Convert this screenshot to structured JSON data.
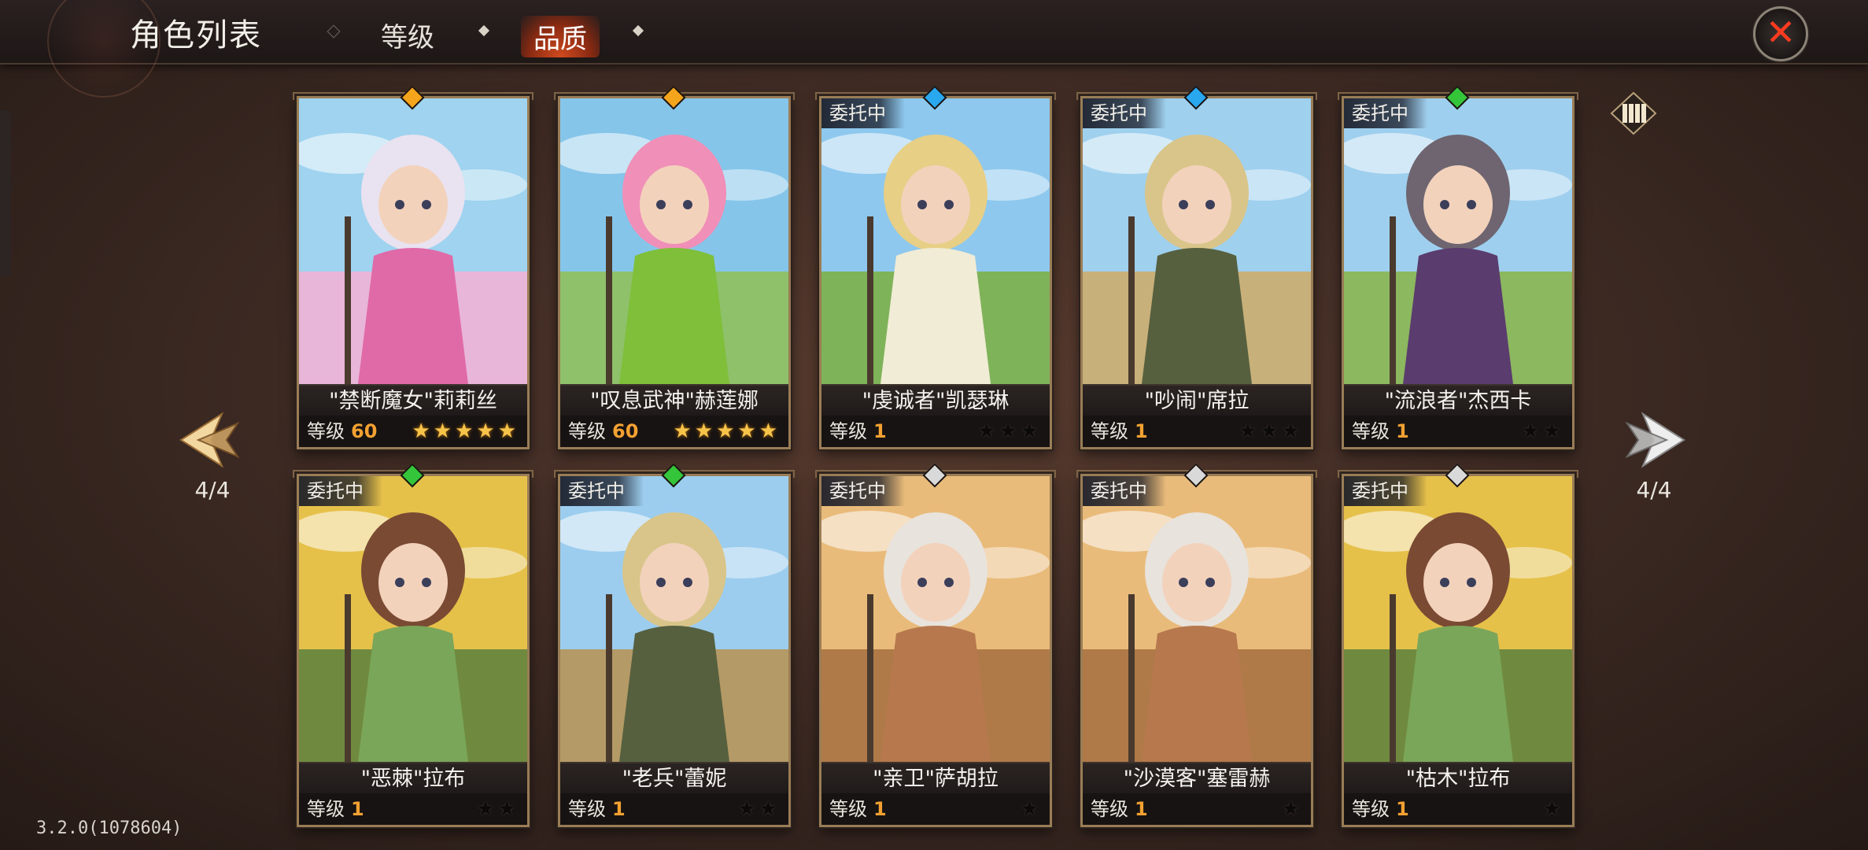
{
  "header": {
    "title": "角色列表",
    "tabs": [
      {
        "label": "等级",
        "active": false
      },
      {
        "label": "品质",
        "active": true
      }
    ],
    "close_icon": "close-icon"
  },
  "pagination": {
    "left_indicator": "4/4",
    "right_indicator": "4/4"
  },
  "colors": {
    "gold": "#f7c44a",
    "level_orange": "#f3a132",
    "close_red": "#ff3b1f",
    "gem_orange": "#f4a51c",
    "gem_blue": "#29a8f0",
    "gem_green": "#35c53a",
    "gem_white": "#d9d9d9"
  },
  "level_label": "等级",
  "cards": [
    {
      "name": "\"禁断魔女\"莉莉丝",
      "level": "60",
      "stars": "★★★★★",
      "star_style": "gold",
      "gem": "orange",
      "commission": ""
    },
    {
      "name": "\"叹息武神\"赫莲娜",
      "level": "60",
      "stars": "★★★★★",
      "star_style": "gold",
      "gem": "orange",
      "commission": ""
    },
    {
      "name": "\"虔诚者\"凯瑟琳",
      "level": "1",
      "stars": "★★★",
      "star_style": "dark",
      "gem": "blue",
      "commission": "委托中"
    },
    {
      "name": "\"吵闹\"席拉",
      "level": "1",
      "stars": "★★★",
      "star_style": "dark",
      "gem": "blue",
      "commission": "委托中"
    },
    {
      "name": "\"流浪者\"杰西卡",
      "level": "1",
      "stars": "★★",
      "star_style": "dark",
      "gem": "green",
      "commission": "委托中"
    },
    {
      "name": "\"恶棘\"拉布",
      "level": "1",
      "stars": "★★",
      "star_style": "dark",
      "gem": "green",
      "commission": "委托中"
    },
    {
      "name": "\"老兵\"蕾妮",
      "level": "1",
      "stars": "★★",
      "star_style": "dark",
      "gem": "green",
      "commission": "委托中"
    },
    {
      "name": "\"亲卫\"萨胡拉",
      "level": "1",
      "stars": "★",
      "star_style": "dark",
      "gem": "white",
      "commission": "委托中"
    },
    {
      "name": "\"沙漠客\"塞雷赫",
      "level": "1",
      "stars": "★",
      "star_style": "dark",
      "gem": "white",
      "commission": "委托中"
    },
    {
      "name": "\"枯木\"拉布",
      "level": "1",
      "stars": "★",
      "star_style": "dark",
      "gem": "white",
      "commission": "委托中"
    }
  ],
  "version": "3.2.0(1078604)"
}
